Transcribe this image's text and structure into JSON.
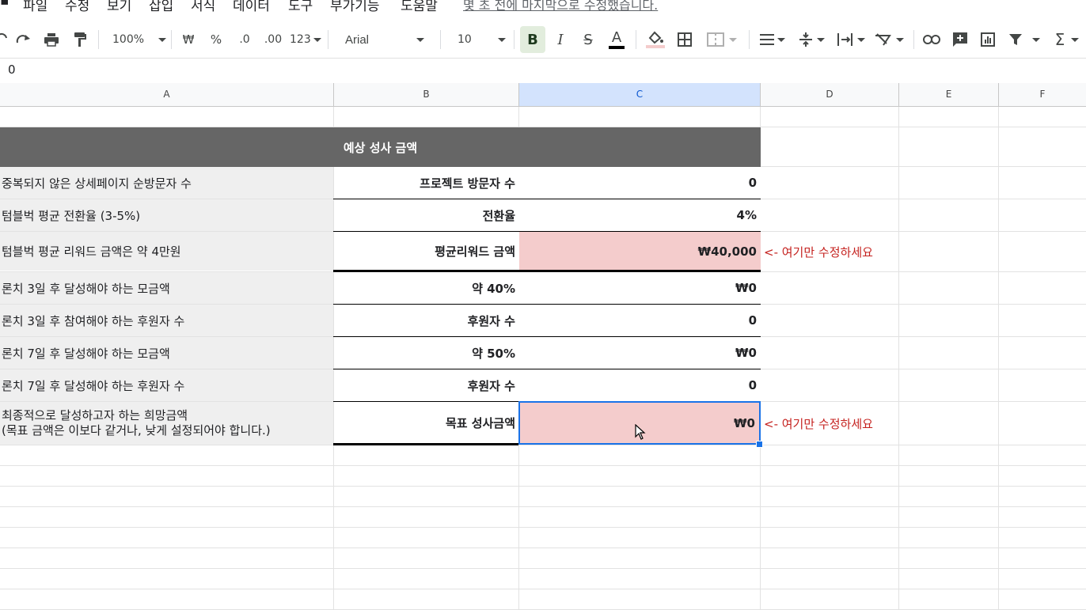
{
  "menu": [
    "파일",
    "수정",
    "보기",
    "삽입",
    "서식",
    "데이터",
    "도구",
    "부가기능",
    "도움말"
  ],
  "last_edit": "몇 초 전에 마지막으로 수정했습니다.",
  "toolbar": {
    "zoom": "100%",
    "currency": "₩",
    "percent": "%",
    "dec_decrease": ".0",
    "dec_increase": ".00",
    "more_formats": "123",
    "font": "Arial",
    "font_size": "10",
    "bold": "B",
    "italic": "I",
    "strike": "S",
    "text_color": "A",
    "sum": "Σ"
  },
  "formula_bar": {
    "value": "0"
  },
  "columns": [
    "A",
    "B",
    "C",
    "D",
    "E",
    "F"
  ],
  "table": {
    "header": "예상 성사 금액",
    "rows": [
      {
        "label": "중복되지 않은 상세페이지 순방문자 수",
        "b": "프로젝트 방문자 수",
        "c": "0"
      },
      {
        "label": "텀블벅 평균 전환율 (3-5%)",
        "b": "전환율",
        "c": "4%"
      },
      {
        "label": "텀블벅 평균 리워드 금액은 약 4만원",
        "b": "평균리워드 금액",
        "c": "₩40,000",
        "note": "<- 여기만 수정하세요"
      },
      {
        "label": "론치 3일 후 달성해야 하는 모금액",
        "b": "약 40%",
        "c": "₩0"
      },
      {
        "label": "론치 3일 후 참여해야 하는 후원자 수",
        "b": "후원자 수",
        "c": "0"
      },
      {
        "label": "론치 7일 후 달성해야 하는 모금액",
        "b": "약 50%",
        "c": "₩0"
      },
      {
        "label": "론치 7일 후 달성해야 하는 후원자 수",
        "b": "후원자 수",
        "c": "0"
      },
      {
        "label": "최종적으로 달성하고자 하는 희망금액",
        "label2": "(목표 금액은 이보다 같거나, 낮게 설정되어야 합니다.)",
        "b": "목표 성사금액",
        "c": "₩0",
        "note": "<- 여기만 수정하세요"
      }
    ]
  },
  "colors": {
    "header_bg": "#666666",
    "label_bg": "#efefef",
    "input_bg": "#f4cccc",
    "note": "#c5221f",
    "selection": "#1a73e8"
  }
}
